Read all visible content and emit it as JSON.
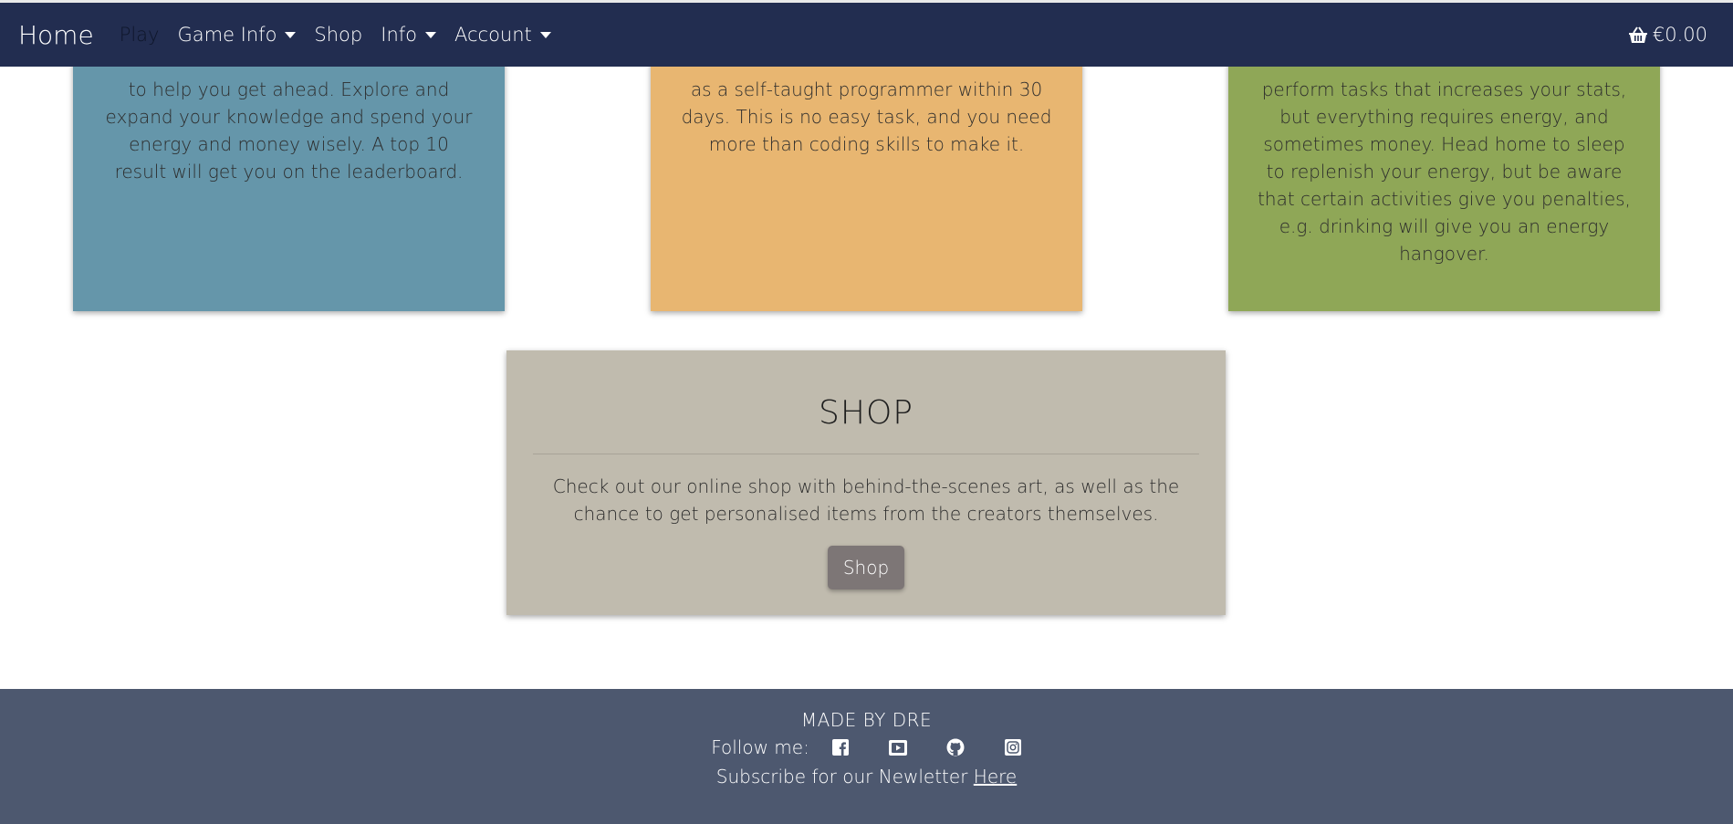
{
  "nav": {
    "brand": "Home",
    "items": [
      {
        "label": "Play",
        "dropdown": false,
        "active": true
      },
      {
        "label": "Game Info",
        "dropdown": true
      },
      {
        "label": "Shop",
        "dropdown": false
      },
      {
        "label": "Info",
        "dropdown": true
      },
      {
        "label": "Account",
        "dropdown": true
      }
    ],
    "cart_total": "€0.00",
    "cart_icon": "basket-icon"
  },
  "cards": {
    "blue": {
      "text": "to help you get ahead. Explore and expand your knowledge and spend your energy and money wisely. A top 10 result will get you on the leaderboard."
    },
    "orange": {
      "text": "as a self-taught programmer within 30 days. This is no easy task, and you need more than coding skills to make it."
    },
    "green": {
      "text": "perform tasks that increases your stats, but everything requires energy, and sometimes money. Head home to sleep to replenish your energy, but be aware that certain activities give you penalties, e.g. drinking will give you an energy hangover."
    }
  },
  "shop": {
    "title": "SHOP",
    "text": "Check out our online shop with behind-the-scenes art, as well as the chance to get personalised items from the creators themselves.",
    "button_label": "Shop"
  },
  "footer": {
    "made_by": "MADE BY DRE",
    "follow_label": "Follow me:",
    "social_icons": [
      "facebook-icon",
      "youtube-icon",
      "github-icon",
      "instagram-icon"
    ],
    "subscribe_text": "Subscribe for our Newletter",
    "subscribe_link": "Here"
  },
  "colors": {
    "navbar": "#222d50",
    "card_blue": "#6596aa",
    "card_orange": "#e8b671",
    "card_green": "#8fa757",
    "shop_card": "#c0bbae",
    "shop_button": "#7d7676",
    "footer": "#4d586f"
  }
}
